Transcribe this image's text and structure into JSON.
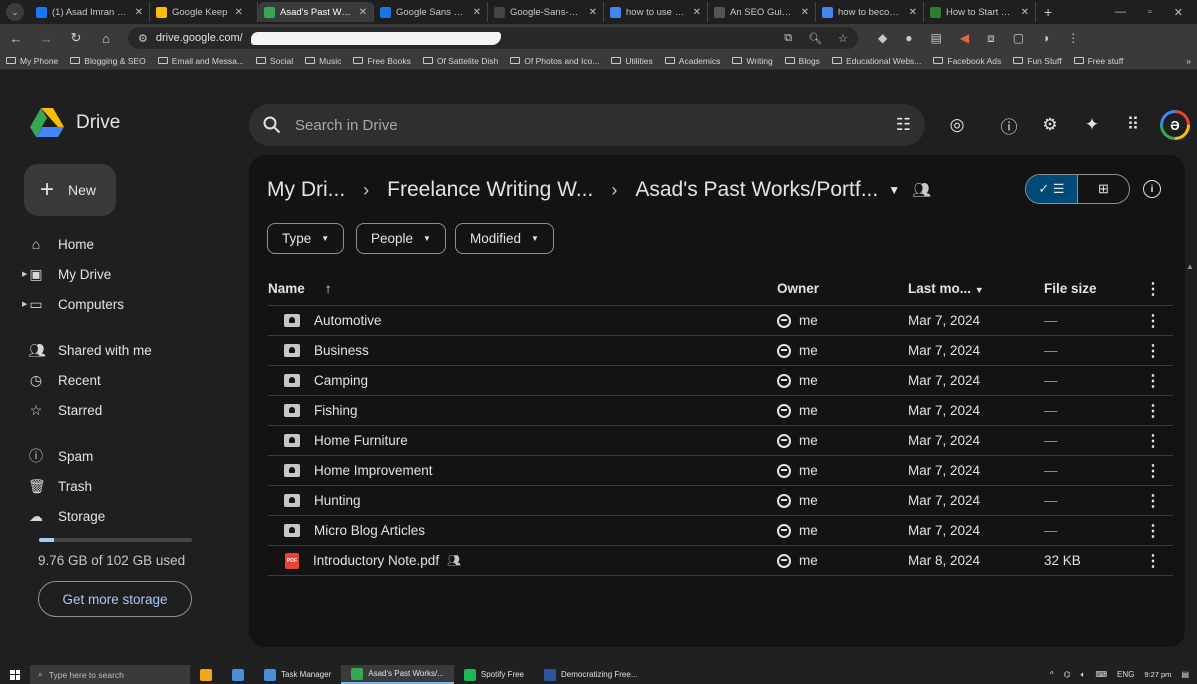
{
  "browser": {
    "tabs": [
      {
        "title": "(1) Asad Imran Sh",
        "favicon_color": "#1877f2",
        "active": false
      },
      {
        "title": "Google Keep",
        "favicon_color": "#fbbc04",
        "active": false
      },
      {
        "title": "Asad's Past Works",
        "favicon_color": "#34a853",
        "active": true
      },
      {
        "title": "Google Sans Font",
        "favicon_color": "#1a73e8",
        "active": false
      },
      {
        "title": "Google-Sans-Font",
        "favicon_color": "#444444",
        "active": false
      },
      {
        "title": "how to use googl",
        "favicon_color": "#4285f4",
        "active": false
      },
      {
        "title": "An SEO Guide to",
        "favicon_color": "#555555",
        "active": false
      },
      {
        "title": "how to become",
        "favicon_color": "#4285f4",
        "active": false
      },
      {
        "title": "How to Start Your",
        "favicon_color": "#2e7d32",
        "active": false
      }
    ],
    "url": "drive.google.com/",
    "bookmarks": [
      "My Phone",
      "Blogging & SEO",
      "Email and Messa...",
      "Social",
      "Music",
      "Free Books",
      "Of Sattelite Dish",
      "Of Photos and Ico...",
      "Utilities",
      "Academics",
      "Writing",
      "Blogs",
      "Educational Webs...",
      "Facebook Ads",
      "Fun Stuff",
      "Free stuff"
    ]
  },
  "header": {
    "app_name": "Drive",
    "search_placeholder": "Search in Drive",
    "accent": "#a8c7fa"
  },
  "sidebar": {
    "new_label": "New",
    "items": [
      {
        "label": "Home",
        "icon": "home-icon"
      },
      {
        "label": "My Drive",
        "icon": "my-drive-icon"
      },
      {
        "label": "Computers",
        "icon": "computers-icon"
      },
      {
        "label": "Shared with me",
        "icon": "shared-with-me-icon"
      },
      {
        "label": "Recent",
        "icon": "clock-icon"
      },
      {
        "label": "Starred",
        "icon": "star-icon"
      },
      {
        "label": "Spam",
        "icon": "spam-icon"
      },
      {
        "label": "Trash",
        "icon": "trash-icon"
      },
      {
        "label": "Storage",
        "icon": "cloud-icon"
      }
    ],
    "storage_text": "9.76 GB of 102 GB used",
    "storage_fraction": 0.0957,
    "get_more_storage": "Get more storage"
  },
  "main": {
    "breadcrumb": [
      "My Dri...",
      "Freelance Writing W...",
      "Asad's Past Works/Portf..."
    ],
    "filters": [
      "Type",
      "People",
      "Modified"
    ],
    "columns": {
      "name": "Name",
      "owner": "Owner",
      "last_modified": "Last mo...",
      "file_size": "File size"
    },
    "rows": [
      {
        "name": "Automotive",
        "type": "folder",
        "owner": "me",
        "date": "Mar 7, 2024",
        "size": "—",
        "shared": false
      },
      {
        "name": "Business",
        "type": "folder",
        "owner": "me",
        "date": "Mar 7, 2024",
        "size": "—",
        "shared": false
      },
      {
        "name": "Camping",
        "type": "folder",
        "owner": "me",
        "date": "Mar 7, 2024",
        "size": "—",
        "shared": false
      },
      {
        "name": "Fishing",
        "type": "folder",
        "owner": "me",
        "date": "Mar 7, 2024",
        "size": "—",
        "shared": false
      },
      {
        "name": "Home Furniture",
        "type": "folder",
        "owner": "me",
        "date": "Mar 7, 2024",
        "size": "—",
        "shared": false
      },
      {
        "name": "Home Improvement",
        "type": "folder",
        "owner": "me",
        "date": "Mar 7, 2024",
        "size": "—",
        "shared": false
      },
      {
        "name": "Hunting",
        "type": "folder",
        "owner": "me",
        "date": "Mar 7, 2024",
        "size": "—",
        "shared": false
      },
      {
        "name": "Micro Blog Articles",
        "type": "folder",
        "owner": "me",
        "date": "Mar 7, 2024",
        "size": "—",
        "shared": false
      },
      {
        "name": "Introductory Note.pdf",
        "type": "pdf",
        "owner": "me",
        "date": "Mar 8, 2024",
        "size": "32 KB",
        "shared": true
      }
    ]
  },
  "taskbar": {
    "search_placeholder": "Type here to search",
    "apps": [
      {
        "label": "Task Manager",
        "color": "#4a90d9",
        "active": false
      },
      {
        "label": "Asad's Past Works/...",
        "color": "#34a853",
        "active": true
      },
      {
        "label": "Spotify Free",
        "color": "#1db954",
        "active": false
      },
      {
        "label": "Democratizing Free...",
        "color": "#2b579a",
        "active": false
      }
    ],
    "lang": "ENG",
    "time": "9:27 pm"
  }
}
